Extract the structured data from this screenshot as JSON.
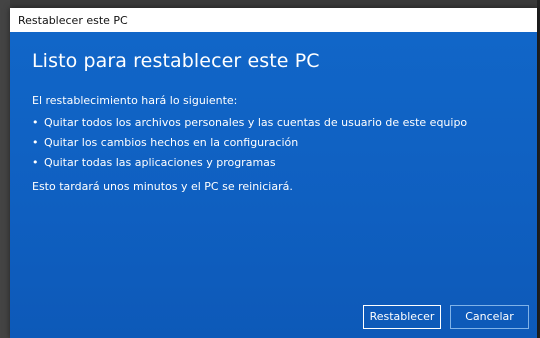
{
  "window": {
    "title": "Restablecer este PC"
  },
  "main": {
    "heading": "Listo para restablecer este PC",
    "intro": "El restablecimiento hará lo siguiente:",
    "bullets": [
      "Quitar todos los archivos personales y las cuentas de usuario de este equipo",
      "Quitar los cambios hechos en la configuración",
      "Quitar todas las aplicaciones y programas"
    ],
    "note": "Esto tardará unos minutos y el PC se reiniciará."
  },
  "buttons": {
    "reset_label": "Restablecer",
    "cancel_label": "Cancelar"
  },
  "colors": {
    "dialog_background": "#0f5fc0",
    "titlebar_background": "#ffffff",
    "text": "#ffffff"
  }
}
